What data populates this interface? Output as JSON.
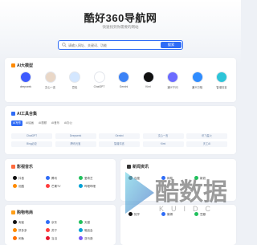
{
  "site": {
    "title": "酷好360导航网",
    "subtitle": "快速找到你需要的网站"
  },
  "search": {
    "placeholder": "请输入网址、关键词、功能",
    "button": "搜索"
  },
  "ai_models": {
    "title": "AI大模型",
    "items": [
      {
        "label": "deepseek",
        "color": "#3d5afe"
      },
      {
        "label": "文心一言",
        "color": "#e9d7c7"
      },
      {
        "label": "豆包",
        "color": "#d4e7ff"
      },
      {
        "label": "ChatGPT",
        "color": "#ffffff"
      },
      {
        "label": "Gemini",
        "color": "#3b82f6"
      },
      {
        "label": "Kimi",
        "color": "#111111"
      },
      {
        "label": "通义千问",
        "color": "#6b6bff"
      },
      {
        "label": "通义万相",
        "color": "#2f8cff"
      },
      {
        "label": "智谱清言",
        "color": "#2dc4d8"
      }
    ]
  },
  "ai_tools": {
    "title": "AI工具合集",
    "tabs": [
      "AI写作",
      "AI绘画",
      "AI视频",
      "AI音乐",
      "AI办公"
    ],
    "active_tab": 0,
    "cells": [
      "ChatGPT",
      "Deepseek",
      "Gemini",
      "文心一言",
      "讯飞星火",
      "Bing必应",
      "腾讯元宝",
      "智谱清言",
      "Kimi",
      "天工AI"
    ]
  },
  "section_left": {
    "title": "影视音乐",
    "rows": [
      [
        "抖音",
        "腾讯",
        "爱奇艺"
      ],
      [
        "优酷",
        "芒果TV",
        "哔哩哔哩"
      ]
    ]
  },
  "section_right": {
    "title": "新闻资讯",
    "rows": [
      [
        "百度",
        "网易",
        "新浪"
      ]
    ]
  },
  "section_left2": {
    "title": "购物电商",
    "rows": [
      [
        "淘宝",
        "京东",
        "天猫"
      ],
      [
        "拼多多",
        "苏宁",
        "唯品会"
      ],
      [
        "闲鱼",
        "当当",
        "亚马逊"
      ]
    ]
  },
  "section_right2": {
    "rows": [
      [
        "知乎",
        "微博",
        "豆瓣"
      ]
    ]
  },
  "watermark": {
    "text": "酷数据",
    "letters": "KUIDC"
  }
}
